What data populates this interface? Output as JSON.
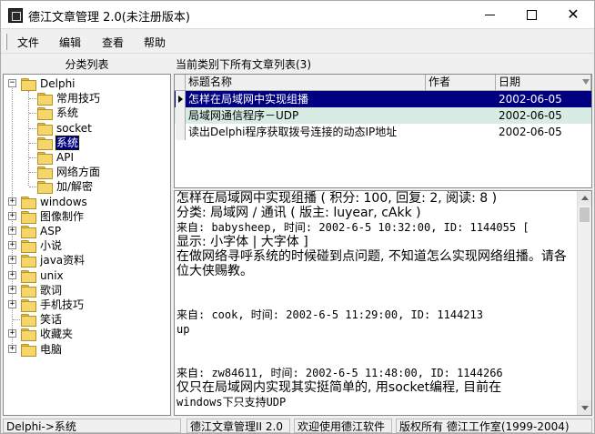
{
  "window": {
    "title": "德江文章管理 2.0(未注册版本)"
  },
  "menu": {
    "items": [
      "文件",
      "编辑",
      "查看",
      "帮助"
    ]
  },
  "left_panel": {
    "header": "分类列表",
    "tree": [
      {
        "label": "Delphi",
        "level": 0,
        "expander": "−",
        "selected": false
      },
      {
        "label": "常用技巧",
        "level": 1,
        "expander": "",
        "selected": false
      },
      {
        "label": "系统",
        "level": 1,
        "expander": "",
        "selected": false
      },
      {
        "label": "socket",
        "level": 1,
        "expander": "",
        "selected": false
      },
      {
        "label": "系统",
        "level": 1,
        "expander": "",
        "selected": true
      },
      {
        "label": "API",
        "level": 1,
        "expander": "",
        "selected": false
      },
      {
        "label": "网络方面",
        "level": 1,
        "expander": "",
        "selected": false
      },
      {
        "label": "加/解密",
        "level": 1,
        "expander": "",
        "selected": false
      },
      {
        "label": "windows",
        "level": 0,
        "expander": "+",
        "selected": false
      },
      {
        "label": "图像制作",
        "level": 0,
        "expander": "+",
        "selected": false
      },
      {
        "label": "ASP",
        "level": 0,
        "expander": "+",
        "selected": false
      },
      {
        "label": "小说",
        "level": 0,
        "expander": "+",
        "selected": false
      },
      {
        "label": "java资料",
        "level": 0,
        "expander": "+",
        "selected": false
      },
      {
        "label": "unix",
        "level": 0,
        "expander": "+",
        "selected": false
      },
      {
        "label": "歌词",
        "level": 0,
        "expander": "+",
        "selected": false
      },
      {
        "label": "手机技巧",
        "level": 0,
        "expander": "+",
        "selected": false
      },
      {
        "label": "笑话",
        "level": 0,
        "expander": "",
        "selected": false
      },
      {
        "label": "收藏夹",
        "level": 0,
        "expander": "+",
        "selected": false
      },
      {
        "label": "电脑",
        "level": 0,
        "expander": "+",
        "selected": false
      }
    ]
  },
  "article_list": {
    "header": "当前类别下所有文章列表(3)",
    "columns": [
      "标题名称",
      "作者",
      "日期"
    ],
    "rows": [
      {
        "title": "怎样在局域网中实现组播",
        "author": "",
        "date": "2002-06-05",
        "active": true
      },
      {
        "title": "局域网通信程序－UDP",
        "author": "",
        "date": "2002-06-05",
        "active": false
      },
      {
        "title": "读出Delphi程序获取拨号连接的动态IP地址",
        "author": "",
        "date": "2002-06-05",
        "active": false
      }
    ]
  },
  "article": {
    "header_line": "怎样在局域网中实现组播 ( 积分: 100, 回复: 2, 阅读: 8 )",
    "category_line": "分类: 局域网 / 通讯 ( 版主: luyear, cAkk )",
    "from_line_1": "来自: babysheep, 时间: 2002-6-5 10:32:00, ID: 1144055 [",
    "display_line": "显示: 小字体 | 大字体 ]",
    "body_1": "在做网络寻呼系统的时候碰到点问题, 不知道怎么实现网络组播。请各位大侠赐教。",
    "from_line_2": "来自: cook, 时间: 2002-6-5 11:29:00, ID: 1144213",
    "reply_2": "up",
    "from_line_3": "来自: zw84611, 时间: 2002-6-5 11:48:00, ID: 1144266",
    "reply_3a": "仅只在局域网内实现其实挺简单的, 用socket编程, 目前在",
    "reply_3b": "windows下只支持UDP"
  },
  "status_bar": {
    "path": "Delphi->系统",
    "app": "德江文章管理II 2.0",
    "welcome": "欢迎使用德江软件",
    "copyright": "版权所有 德江工作室(1999-2004)"
  },
  "colors": {
    "selection": "#000080",
    "alt_row": "#d8ece4",
    "folder": "#f5d66a"
  },
  "icons": [
    "app-icon",
    "minimize-icon",
    "maximize-icon",
    "close-icon",
    "folder-icon",
    "row-pointer-icon",
    "sort-arrow-icon",
    "scroll-up-icon",
    "scroll-down-icon"
  ]
}
